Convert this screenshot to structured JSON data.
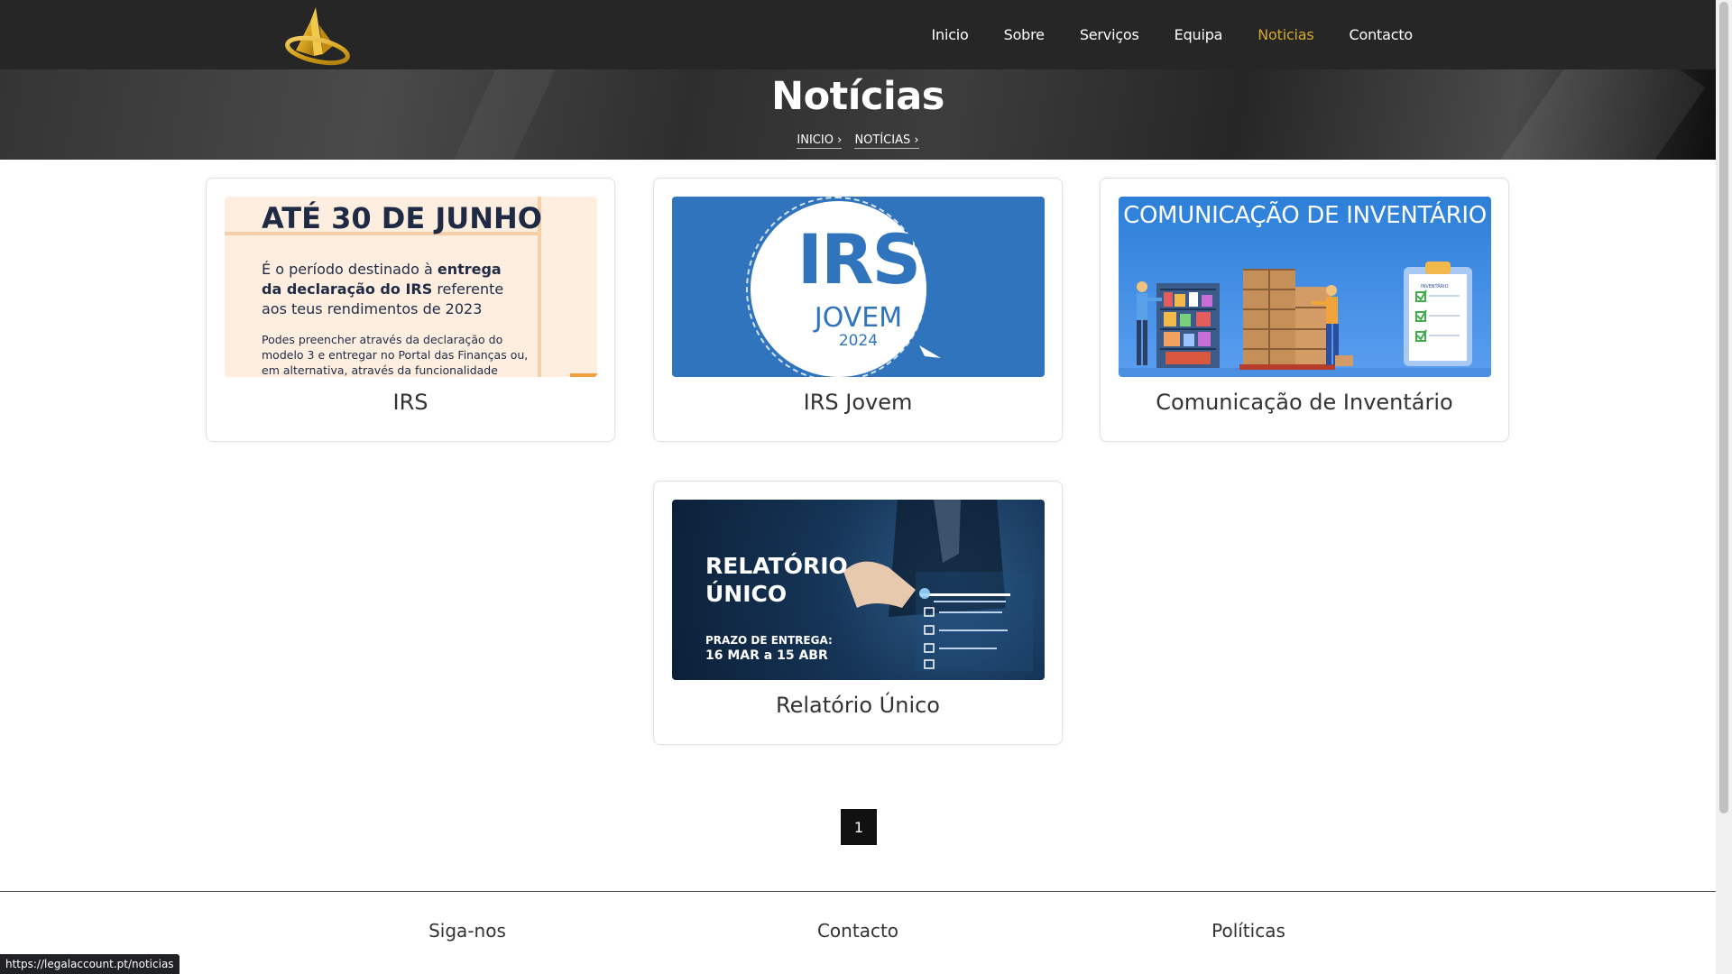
{
  "nav": {
    "logo_alt": "logo",
    "items": [
      {
        "label": "Inicio"
      },
      {
        "label": "Sobre"
      },
      {
        "label": "Serviços"
      },
      {
        "label": "Equipa"
      },
      {
        "label": "Noticias",
        "active": true
      },
      {
        "label": "Contacto"
      }
    ],
    "active_color": "#d4a82e"
  },
  "hero": {
    "title": "Notícias",
    "breadcrumb": [
      "INICIO",
      "NOTÍCIAS"
    ]
  },
  "cards": [
    {
      "title": "IRS",
      "thumb": {
        "heading": "ATÉ 30 DE JUNHO",
        "p1_a": "É o período destinado à ",
        "p1_b": "entrega da declaração do IRS",
        "p1_c": " referente aos teus rendimentos de 2023",
        "p2": "Podes preencher através da declaração do modelo 3 e entregar no Portal das Finanças ou, em alternativa, através da funcionalidade"
      }
    },
    {
      "title": "IRS Jovem",
      "thumb": {
        "big": "IRS",
        "mid": "JOVEM",
        "year": "2024"
      }
    },
    {
      "title": "Comunicação de Inventário",
      "thumb": {
        "heading": "COMUNICAÇÃO DE INVENTÁRIO",
        "clipboard": "INVENTÁRIO"
      }
    },
    {
      "title": "Relatório Único",
      "thumb": {
        "line1": "RELATÓRIO",
        "line2": "ÚNICO",
        "sub1": "PRAZO DE ENTREGA:",
        "sub2": "16 MAR a 15 ABR"
      }
    }
  ],
  "pagination": {
    "current": "1"
  },
  "footer": {
    "cols": [
      "Siga-nos",
      "Contacto",
      "Políticas"
    ]
  },
  "status_url": "https://legalaccount.pt/noticias"
}
